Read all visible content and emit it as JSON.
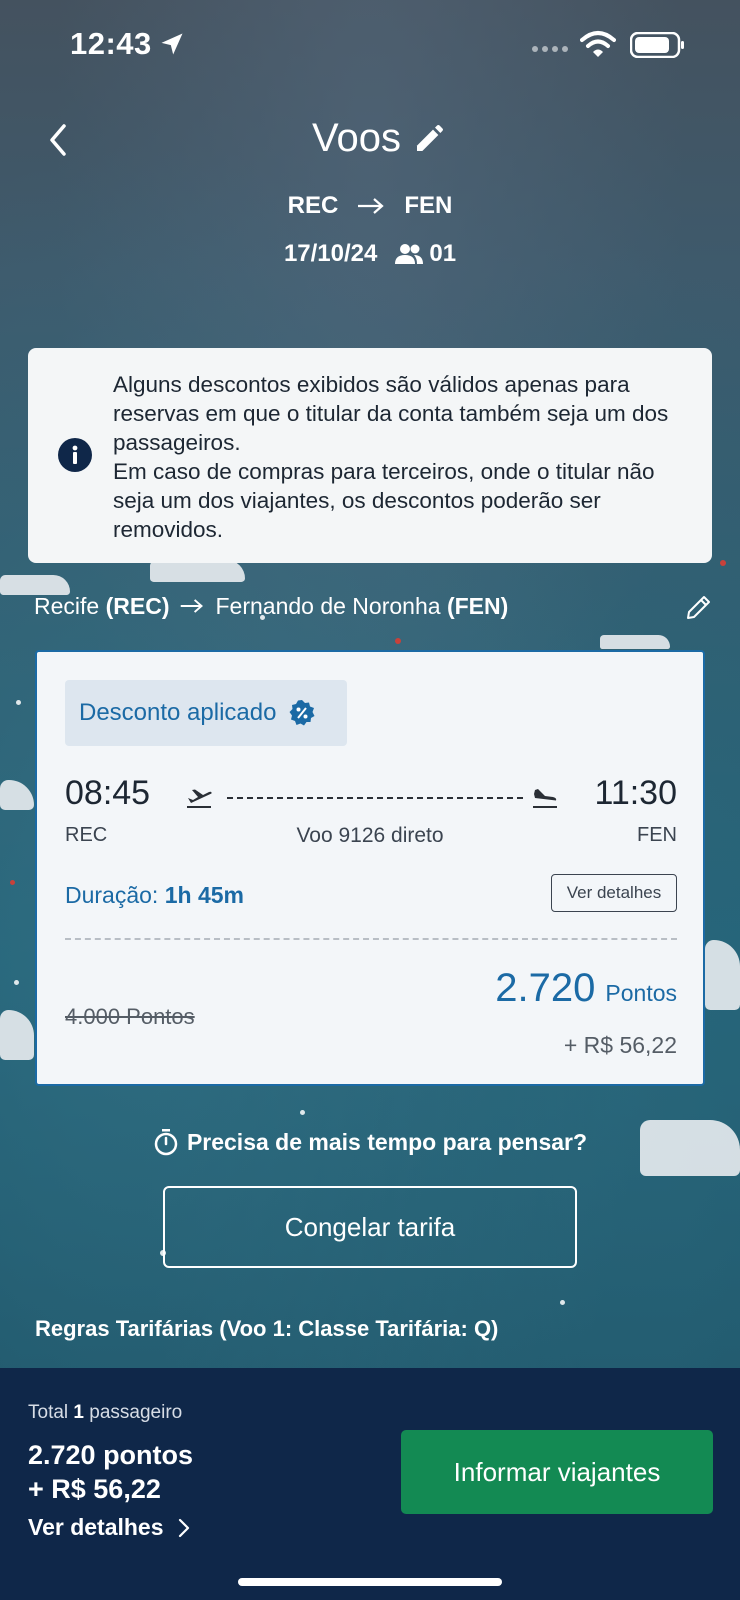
{
  "status_bar": {
    "time": "12:43"
  },
  "nav": {
    "title": "Voos"
  },
  "search": {
    "origin": "REC",
    "destination": "FEN",
    "date": "17/10/24",
    "passengers": "01"
  },
  "notice": {
    "text": "Alguns descontos exibidos são válidos apenas para reservas em que o titular da conta também seja um dos passageiros.\nEm caso de compras para terceiros, onde o titular não seja um dos viajantes, os descontos poderão ser removidos."
  },
  "route": {
    "origin_city": "Recife",
    "origin_code": "(REC)",
    "dest_city": "Fernando de Noronha",
    "dest_code": "(FEN)"
  },
  "flight": {
    "badge": "Desconto aplicado",
    "departure_time": "08:45",
    "arrival_time": "11:30",
    "departure_code": "REC",
    "arrival_code": "FEN",
    "flight_info": "Voo 9126 direto",
    "duration_label": "Duração:",
    "duration_value": "1h 45m",
    "details_button": "Ver detalhes",
    "old_price": "4.000 Pontos",
    "new_price_value": "2.720",
    "new_price_unit": "Pontos",
    "fee": "+ R$ 56,22"
  },
  "freeze": {
    "question": "Precisa de mais tempo para pensar?",
    "button": "Congelar tarifa"
  },
  "rules": {
    "label": "Regras Tarifárias (Voo 1: Classe Tarifária: Q)"
  },
  "footer": {
    "total_prefix": "Total",
    "total_count": "1",
    "total_suffix": "passageiro",
    "points": "2.720 pontos",
    "fee": "+ R$ 56,22",
    "details": "Ver detalhes",
    "cta": "Informar viajantes"
  },
  "colors": {
    "accent": "#1b6aa5",
    "cta": "#138a53",
    "footer_bg": "#0f2749"
  },
  "icons": [
    "location-arrow-icon",
    "wifi-icon",
    "battery-icon",
    "back-icon",
    "edit-icon",
    "arrow-right-icon",
    "people-icon",
    "info-icon",
    "pencil-icon",
    "discount-icon",
    "takeoff-icon",
    "landing-icon",
    "timer-icon",
    "chevron-right-icon"
  ]
}
